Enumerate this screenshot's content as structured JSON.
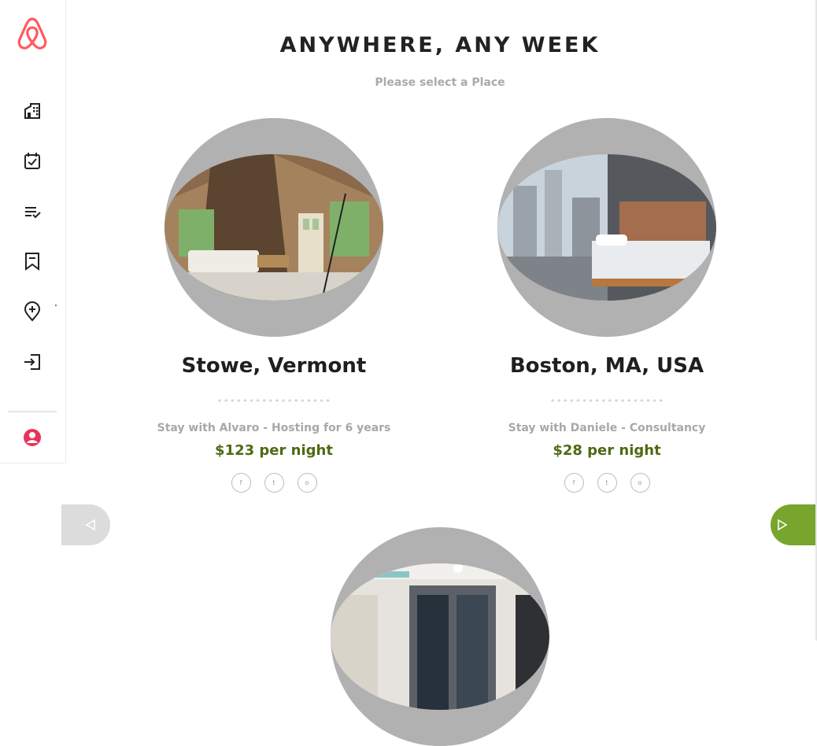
{
  "header": {
    "title": "ANYWHERE, ANY WEEK",
    "subtitle": "Please select a Place"
  },
  "sidebar": {
    "logo_icon": "airbnb-logo-icon",
    "brand_color": "#ff5a5f",
    "items": [
      {
        "icon": "buildings-icon"
      },
      {
        "icon": "calendar-check-icon"
      },
      {
        "icon": "checklist-icon"
      },
      {
        "icon": "bookmark-icon"
      },
      {
        "icon": "location-add-icon"
      },
      {
        "icon": "login-icon"
      }
    ],
    "profile_icon": "user-circle-icon"
  },
  "listings": [
    {
      "place": "Stowe, Vermont",
      "host": "Stay with Alvaro - Hosting for 6 years",
      "price": "$123 per night",
      "socials": [
        "f",
        "t",
        "o"
      ]
    },
    {
      "place": "Boston, MA, USA",
      "host": "Stay with Daniele - Consultancy",
      "price": "$28 per night",
      "socials": [
        "f",
        "t",
        "o"
      ]
    }
  ],
  "colors": {
    "accent_green": "#78a52b",
    "price_green": "#4e6a12",
    "circle_grey": "#b1b1b1"
  }
}
